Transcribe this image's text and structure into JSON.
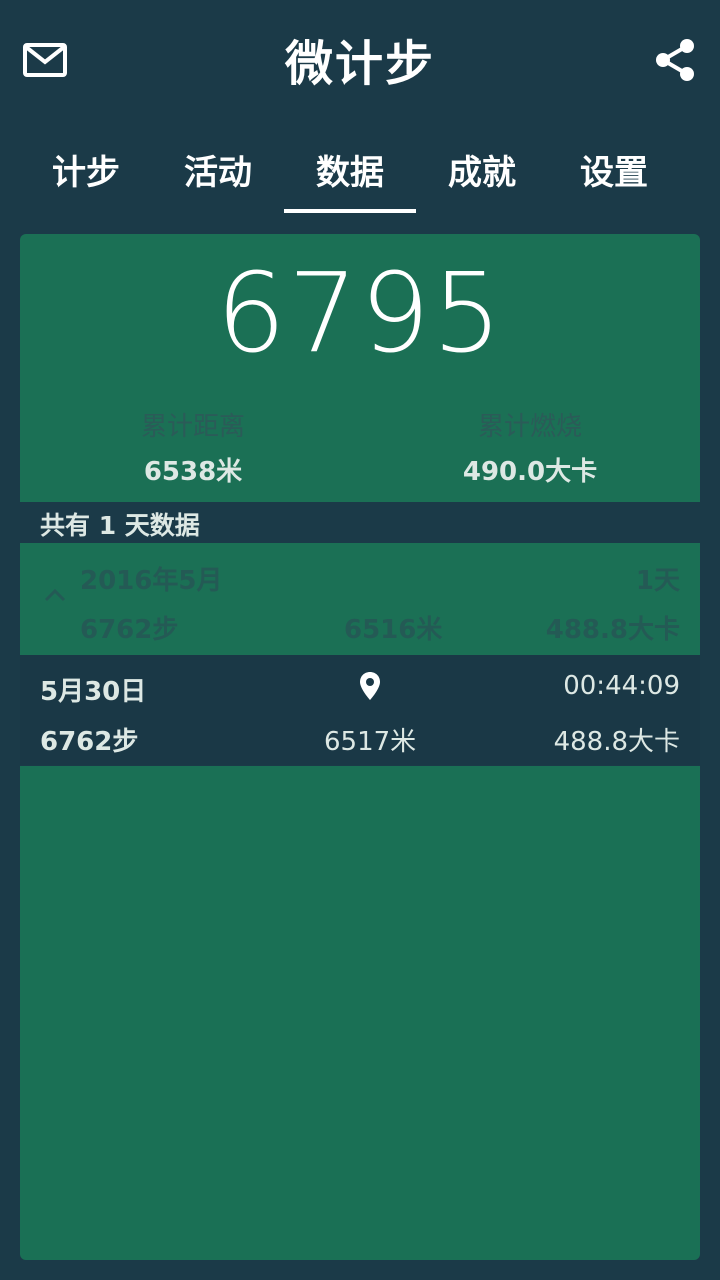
{
  "app": {
    "title": "微计步"
  },
  "tabs": [
    {
      "label": "计步",
      "active": false
    },
    {
      "label": "活动",
      "active": false
    },
    {
      "label": "数据",
      "active": true
    },
    {
      "label": "成就",
      "active": false
    },
    {
      "label": "设置",
      "active": false
    }
  ],
  "summary": {
    "total_steps": "6795",
    "distance_label": "累计距离",
    "distance_value": "6538米",
    "calories_label": "累计燃烧",
    "calories_value": "490.0大卡"
  },
  "days_count": "共有 1 天数据",
  "month": {
    "label": "2016年5月",
    "days": "1天",
    "steps": "6762步",
    "distance": "6516米",
    "calories": "488.8大卡"
  },
  "day": {
    "date": "5月30日",
    "duration": "00:44:09",
    "steps": "6762步",
    "distance": "6517米",
    "calories": "488.8大卡"
  },
  "icons": {
    "mail": "mail-icon",
    "share": "share-icon",
    "chevron": "chevron-up-icon",
    "location": "location-pin-icon"
  },
  "colors": {
    "background": "#1b3a48",
    "card": "#1b7055",
    "muted_text": "#2b5b58"
  }
}
